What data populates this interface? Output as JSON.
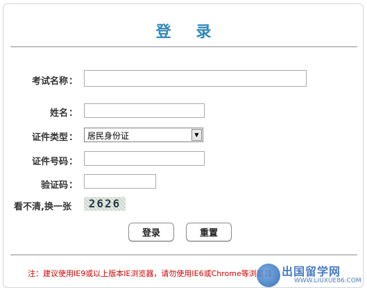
{
  "title": "登 录",
  "form": {
    "exam_name_label": "考试名称",
    "name_label": "姓名",
    "id_type_label": "证件类型",
    "id_type_selected": "居民身份证",
    "id_number_label": "证件号码",
    "captcha_label": "验证码",
    "colon": "：",
    "exam_name_value": "",
    "name_value": "",
    "id_number_value": "",
    "captcha_value": ""
  },
  "captcha": {
    "image_text": "2626",
    "refresh_text": "看不清,换一张"
  },
  "buttons": {
    "login": "登录",
    "reset": "重置"
  },
  "notice": "注：建议使用IE9或以上版本IE浏览器，请勿使用IE6或Chrome等浏览器",
  "watermark": {
    "brand": "出国留学网",
    "url": "WWW.LIUXUE86.COM"
  },
  "icons": {
    "select_arrow": "chevron-down-icon"
  }
}
